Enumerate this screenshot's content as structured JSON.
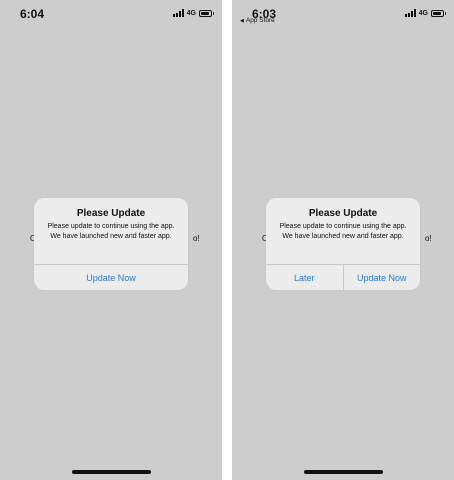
{
  "left_screen": {
    "time": "6:04",
    "network": "4G",
    "background_text": {
      "left": "O",
      "right": "o!"
    },
    "alert": {
      "title": "Please Update",
      "message": "Please update to continue using the app. We have launched new and faster app.",
      "buttons": [
        "Update Now"
      ]
    }
  },
  "right_screen": {
    "time": "6:03",
    "back_label": "App Store",
    "network": "4G",
    "background_text": {
      "left": "O",
      "right": "o!"
    },
    "alert": {
      "title": "Please Update",
      "message": "Please update to continue using the app. We have launched new and faster app.",
      "buttons": [
        "Later",
        "Update Now"
      ]
    }
  },
  "colors": {
    "screen_background": "#cdcdcd",
    "alert_background": "#ececec",
    "button_text": "#2a7ad6"
  },
  "icons": [
    "signal-icon",
    "battery-icon",
    "back-caret-icon"
  ]
}
